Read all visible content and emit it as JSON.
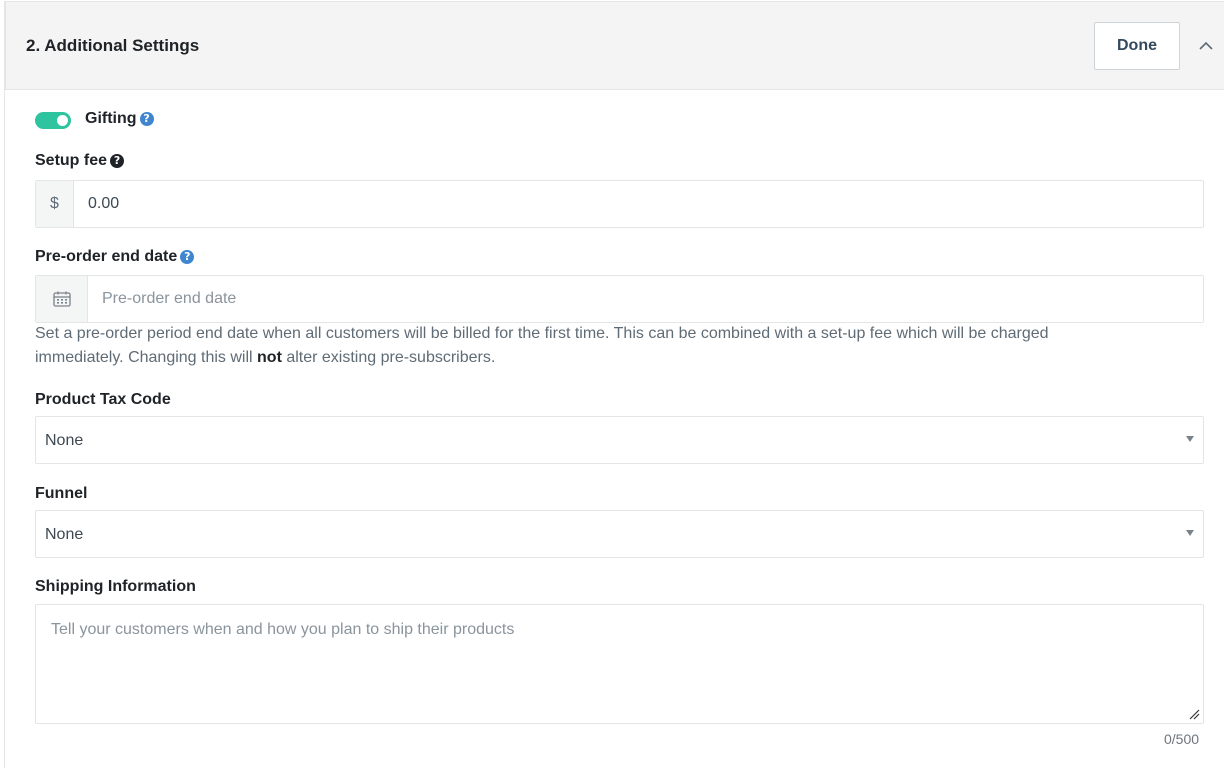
{
  "header": {
    "title": "2. Additional Settings",
    "done_label": "Done",
    "collapse_icon": "chevron-up-icon"
  },
  "gifting": {
    "label": "Gifting",
    "enabled": true,
    "toggle_color": "#2ec4a0",
    "help_icon": "question-circle-icon"
  },
  "setup_fee": {
    "label": "Setup fee",
    "currency": "$",
    "value": "0.00",
    "help_icon": "question-circle-icon"
  },
  "preorder": {
    "label": "Pre-order end date",
    "placeholder": "Pre-order end date",
    "icon": "calendar-icon",
    "help_pre": "Set a pre-order period end date when all customers will be billed for the first time. This can be combined with a set-up fee which will be charged immediately. Changing this will ",
    "help_bold": "not",
    "help_post": " alter existing pre-subscribers."
  },
  "tax_code": {
    "label": "Product Tax Code",
    "value": "None"
  },
  "funnel": {
    "label": "Funnel",
    "value": "None"
  },
  "shipping": {
    "label": "Shipping Information",
    "placeholder": "Tell your customers when and how you plan to ship their products",
    "counter": "0/500"
  }
}
